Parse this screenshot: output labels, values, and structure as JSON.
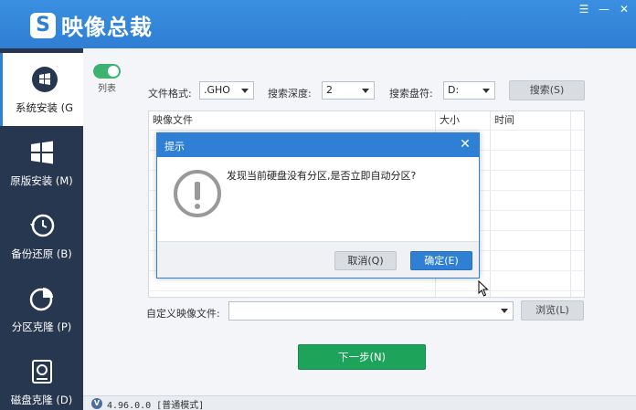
{
  "app": {
    "title": "映像总裁",
    "logo_letter": "S"
  },
  "window_controls": {
    "menu": "☰",
    "minimize": "—",
    "close": "✕"
  },
  "sidebar": {
    "items": [
      {
        "label": "系统安装 (G",
        "active": true
      },
      {
        "label": "原版安装 (M)"
      },
      {
        "label": "备份还原 (B)"
      },
      {
        "label": "分区克隆 (P)"
      },
      {
        "label": "磁盘克隆 (D)"
      }
    ]
  },
  "toolbar": {
    "view_toggle_label": "列表",
    "file_format_label": "文件格式:",
    "file_format_value": ".GHO",
    "search_depth_label": "搜索深度:",
    "search_depth_value": "2",
    "search_drive_label": "搜索盘符:",
    "search_drive_value": "D:",
    "search_button": "搜索(S)"
  },
  "table": {
    "headers": [
      "映像文件",
      "大小",
      "时间"
    ]
  },
  "custom_image": {
    "label": "自定义映像文件:",
    "value": "",
    "browse_button": "浏览(L)"
  },
  "next_button": "下一步(N)",
  "status": {
    "version": "4.96.0.0 [普通模式]",
    "badge": "V"
  },
  "dialog": {
    "title": "提示",
    "message": "发现当前硬盘没有分区,是否立即自动分区?",
    "cancel_button": "取消(Q)",
    "ok_button": "确定(E)"
  },
  "colors": {
    "accent": "#2f7fd4",
    "sidebar": "#26374f",
    "next": "#1ea35a"
  }
}
